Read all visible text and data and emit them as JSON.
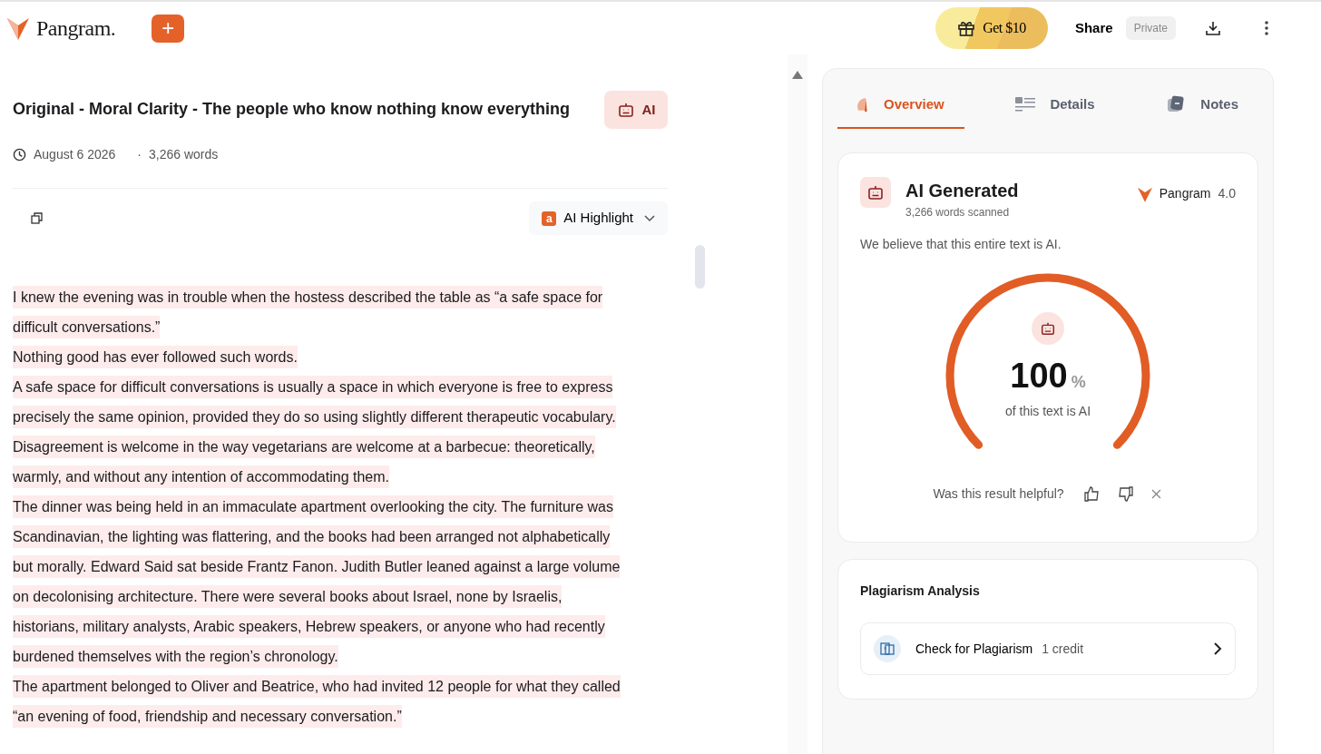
{
  "header": {
    "logo": "Pangram.",
    "new_button": "+",
    "promo": "Get $10",
    "share": "Share",
    "visibility": "Private"
  },
  "document": {
    "title": "Original - Moral Clarity - The people who know nothing know everything",
    "verdict_badge": "AI",
    "date": "August 6 2026",
    "separator": "·",
    "word_count": "3,266 words",
    "highlight_menu": {
      "icon_letter": "a",
      "label": "AI Highlight"
    },
    "paragraphs": [
      {
        "highlighted": true,
        "lines": [
          "I knew the evening was in trouble when the hostess described the table as “a safe space for",
          "difficult conversations.”"
        ]
      },
      {
        "highlighted": true,
        "lines": [
          "Nothing good has ever followed such words."
        ]
      },
      {
        "highlighted": true,
        "lines": [
          "A safe space for difficult conversations is usually a space in which everyone is free to express",
          "precisely the same opinion, provided they do so using slightly different therapeutic vocabulary.",
          "Disagreement is welcome in the way vegetarians are welcome at a barbecue: theoretically,",
          "warmly, and without any intention of accommodating them."
        ]
      },
      {
        "highlighted": true,
        "lines": [
          "The dinner was being held in an immaculate apartment overlooking the city. The furniture was",
          "Scandinavian, the lighting was flattering, and the books had been arranged not alphabetically",
          "but morally. Edward Said sat beside Frantz Fanon. Judith Butler leaned against a large volume",
          "on decolonising architecture. There were several books about Israel, none by Israelis,",
          "historians, military analysts, Arabic speakers, Hebrew speakers, or anyone who had recently",
          "burdened themselves with the region’s chronology."
        ]
      },
      {
        "highlighted": true,
        "lines": [
          "The apartment belonged to Oliver and Beatrice, who had invited 12 people for what they called",
          "“an evening of food, friendship and necessary conversation.”"
        ]
      }
    ]
  },
  "panel": {
    "tabs": [
      {
        "label": "Overview",
        "selected": true
      },
      {
        "label": "Details",
        "selected": false
      },
      {
        "label": "Notes",
        "selected": false
      }
    ],
    "result": {
      "title": "AI Generated",
      "subtitle": "3,266 words scanned",
      "model_name": "Pangram",
      "model_version": "4.0",
      "summary": "We believe that this entire text is AI.",
      "gauge": {
        "level": 1.0,
        "value": "100",
        "unit": "%",
        "caption": "of this text is AI"
      },
      "feedback_question": "Was this result helpful?"
    },
    "plagiarism": {
      "title": "Plagiarism Analysis",
      "action": "Check for Plagiarism",
      "cost": "1 credit"
    }
  }
}
